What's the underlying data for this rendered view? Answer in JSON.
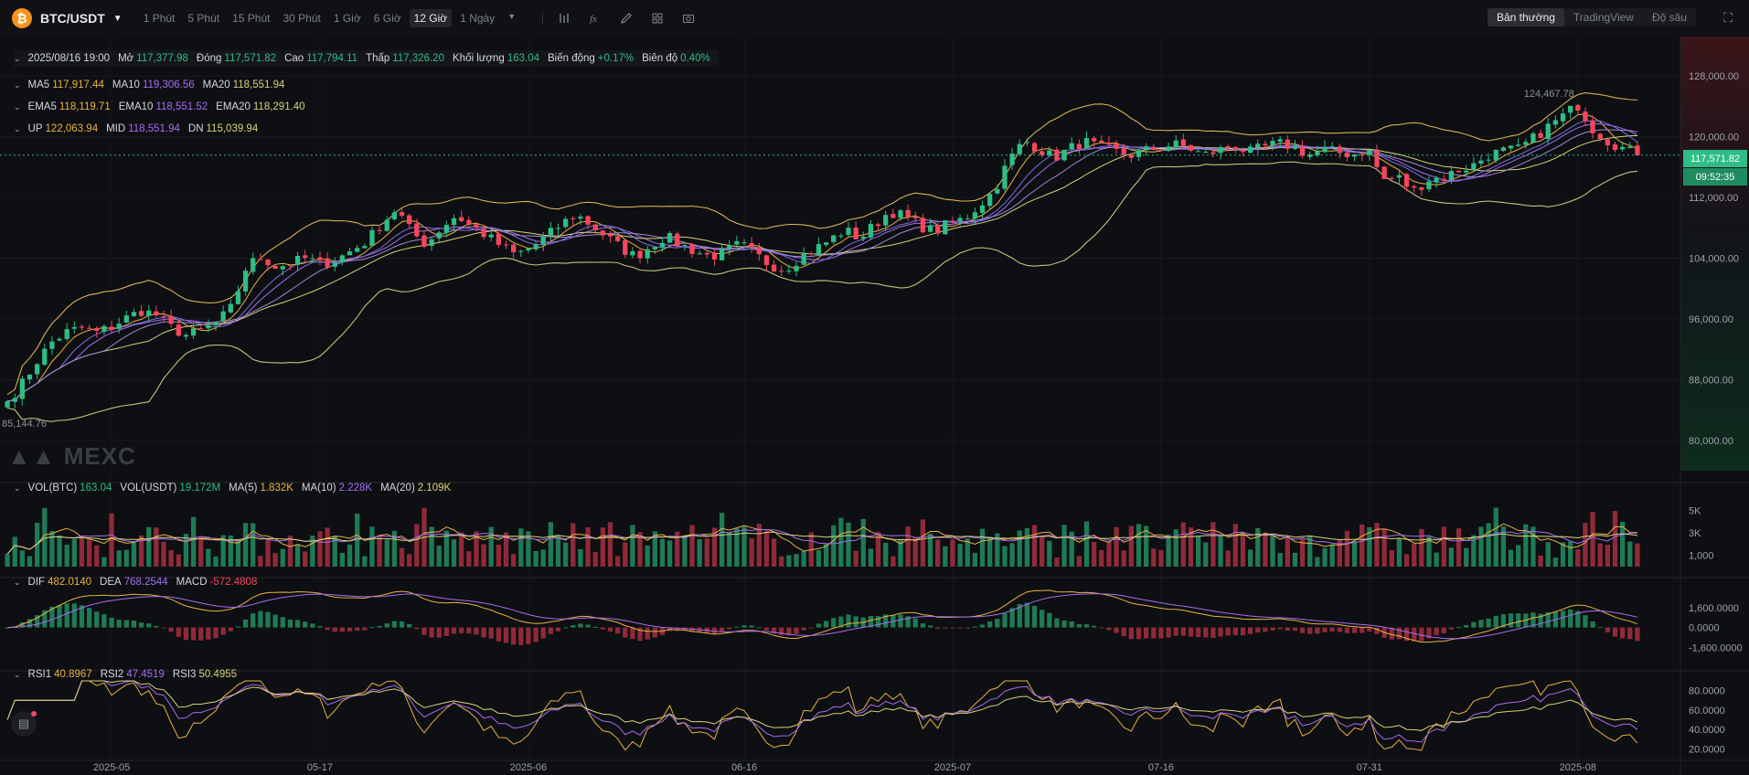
{
  "header": {
    "coin_glyph": "₿",
    "pair": "BTC/USDT",
    "intervals": [
      "1 Phút",
      "5 Phút",
      "15 Phút",
      "30 Phút",
      "1 Giờ",
      "6 Giờ",
      "12 Giờ",
      "1 Ngày"
    ],
    "active_interval": "12 Giờ",
    "tool_icons": [
      "indicator-icon",
      "fx-icon",
      "pencil-icon",
      "layout-icon",
      "camera-icon"
    ],
    "views": [
      "Bản thường",
      "TradingView",
      "Độ sâu"
    ],
    "active_view": "Bản thường"
  },
  "ohlc": {
    "date": "2025/08/16 19:00",
    "open_label": "Mở",
    "open": "117,377.98",
    "close_label": "Đóng",
    "close": "117,571.82",
    "high_label": "Cao",
    "high": "117,794.11",
    "low_label": "Thấp",
    "low": "117,326.20",
    "volume_label": "Khối lượng",
    "volume": "163.04",
    "change_label": "Biến động",
    "change": "+0.17%",
    "amp_label": "Biên độ",
    "amp": "0.40%"
  },
  "ma": {
    "ma5": "117,917.44",
    "ma10": "119,306.56",
    "ma20": "118,551.94"
  },
  "ema": {
    "ema5": "118,119.71",
    "ema10": "118,551.52",
    "ema20": "118,291.40"
  },
  "boll": {
    "up": "122,063.94",
    "mid": "118,551.94",
    "dn": "115,039.94"
  },
  "vol": {
    "vol_btc": "163.04",
    "vol_usdt": "19.172M",
    "ma5": "1.832K",
    "ma10": "2.228K",
    "ma20": "2.109K"
  },
  "macd": {
    "dif": "482.0140",
    "dea": "768.2544",
    "macd": "-572.4808"
  },
  "rsi": {
    "rsi1": "40.8967",
    "rsi2": "47.4519",
    "rsi3": "50.4955"
  },
  "last_price": "117,571.82",
  "countdown": "09:52:35",
  "max_label": "124,467.78",
  "min_label": "85,144.76",
  "watermark": "MEXC",
  "colors": {
    "up": "#2ebd85",
    "down": "#f6465d",
    "ma5": "#e8b342",
    "ma10": "#a66cf2",
    "ma20": "#d8d27a",
    "boll": "#d5b15a",
    "bg": "#0e0f12"
  },
  "chart_data": {
    "type": "candlestick",
    "interval": "12h",
    "x_ticks": [
      "2025-05",
      "05-17",
      "2025-06",
      "06-16",
      "2025-07",
      "07-16",
      "07-31",
      "2025-08"
    ],
    "price_ticks": [
      "128,000.00",
      "120,000.00",
      "112,000.00",
      "104,000.00",
      "96,000.00",
      "88,000.00",
      "80,000.00"
    ],
    "volume_ticks": [
      "5K",
      "3K",
      "1,000"
    ],
    "macd_ticks": [
      "1,600.0000",
      "0.0000",
      "-1,600.0000"
    ],
    "rsi_ticks": [
      "80.0000",
      "60.0000",
      "40.0000",
      "20.0000"
    ],
    "price_range": [
      76000,
      132000
    ],
    "volume_range": [
      0,
      6500
    ],
    "macd_range": [
      -2600,
      3200
    ],
    "rsi_range": [
      10,
      90
    ],
    "close_path": [
      85145,
      87500,
      90500,
      93000,
      94300,
      94800,
      94200,
      95000,
      96200,
      97100,
      96500,
      94800,
      93800,
      94500,
      95500,
      97500,
      103000,
      104200,
      102800,
      103400,
      104000,
      103200,
      103800,
      105000,
      106200,
      108500,
      110500,
      107500,
      105800,
      108000,
      109600,
      108300,
      107000,
      105600,
      104400,
      105400,
      106800,
      108400,
      109800,
      108400,
      106900,
      105400,
      104200,
      105600,
      106900,
      105800,
      104900,
      104200,
      104800,
      105900,
      104500,
      103100,
      102600,
      104100,
      105200,
      106400,
      107700,
      106600,
      108400,
      110200,
      109500,
      108300,
      107500,
      108600,
      109200,
      111000,
      113000,
      117000,
      119500,
      118400,
      117200,
      118400,
      119400,
      118600,
      118100,
      117500,
      118100,
      118600,
      119000,
      118500,
      117600,
      118200,
      118900,
      117900,
      118600,
      119100,
      118700,
      117600,
      118300,
      117900,
      117700,
      118300,
      114300,
      114700,
      112800,
      114400,
      114600,
      115600,
      116200,
      117600,
      118100,
      118300,
      119700,
      121300,
      122700,
      124200,
      121100,
      119500,
      118500,
      117571.82
    ]
  }
}
